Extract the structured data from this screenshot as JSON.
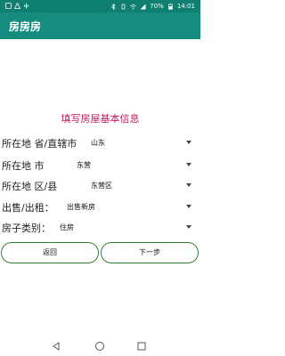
{
  "status_bar": {
    "battery": "70%",
    "time": "14:01"
  },
  "app_bar": {
    "title": "房房房"
  },
  "form": {
    "title": "填写房屋基本信息",
    "rows": [
      {
        "label": "所在地 省/直辖市",
        "value": "山东"
      },
      {
        "label": "所在地 市",
        "value": "东营"
      },
      {
        "label": "所在地 区/县",
        "value": "东营区"
      },
      {
        "label": "出售/出租：",
        "value": "出售新房"
      },
      {
        "label": "房子类别：",
        "value": "住房"
      }
    ]
  },
  "buttons": {
    "back": "返回",
    "next": "下一步"
  },
  "icons": {
    "dropdown": "chevron-down-icon",
    "nav_back": "triangle-back-icon",
    "nav_home": "circle-home-icon",
    "nav_recent": "square-recent-icon"
  },
  "colors": {
    "status_bar": "#0e7f71",
    "app_bar": "#168c7e",
    "title_text": "#c2185b",
    "button_border": "#2e7d32"
  }
}
